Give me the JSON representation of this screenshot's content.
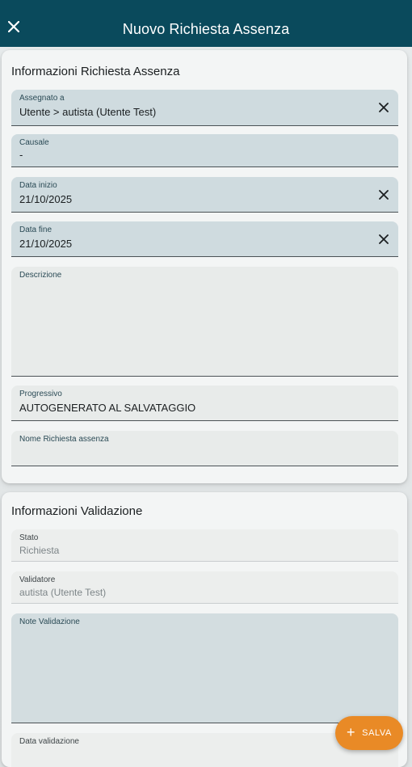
{
  "appbar": {
    "title": "Nuovo Richiesta Assenza",
    "close_icon": "close-icon"
  },
  "section_richiesta": {
    "title": "Informazioni Richiesta Assenza",
    "fields": {
      "assegnato": {
        "label": "Assegnato a",
        "value": "Utente > autista (Utente Test)"
      },
      "causale": {
        "label": "Causale",
        "value": "-"
      },
      "data_inizio": {
        "label": "Data inizio",
        "value": "21/10/2025"
      },
      "data_fine": {
        "label": "Data fine",
        "value": "21/10/2025"
      },
      "descrizione": {
        "label": "Descrizione",
        "value": ""
      },
      "progressivo": {
        "label": "Progressivo",
        "value": "AUTOGENERATO AL SALVATAGGIO"
      },
      "nome": {
        "label": "Nome Richiesta assenza",
        "value": ""
      }
    }
  },
  "section_validazione": {
    "title": "Informazioni Validazione",
    "fields": {
      "stato": {
        "label": "Stato",
        "value": "Richiesta"
      },
      "validatore": {
        "label": "Validatore",
        "value": "autista (Utente Test)"
      },
      "note": {
        "label": "Note Validazione",
        "value": ""
      },
      "data_validazione": {
        "label": "Data validazione",
        "value": ""
      }
    }
  },
  "fab": {
    "label": "SALVA",
    "icon": "plus-icon",
    "color": "#e98a26"
  },
  "colors": {
    "appbar": "#0a4a5c",
    "field_filled": "#cfdbdf"
  }
}
